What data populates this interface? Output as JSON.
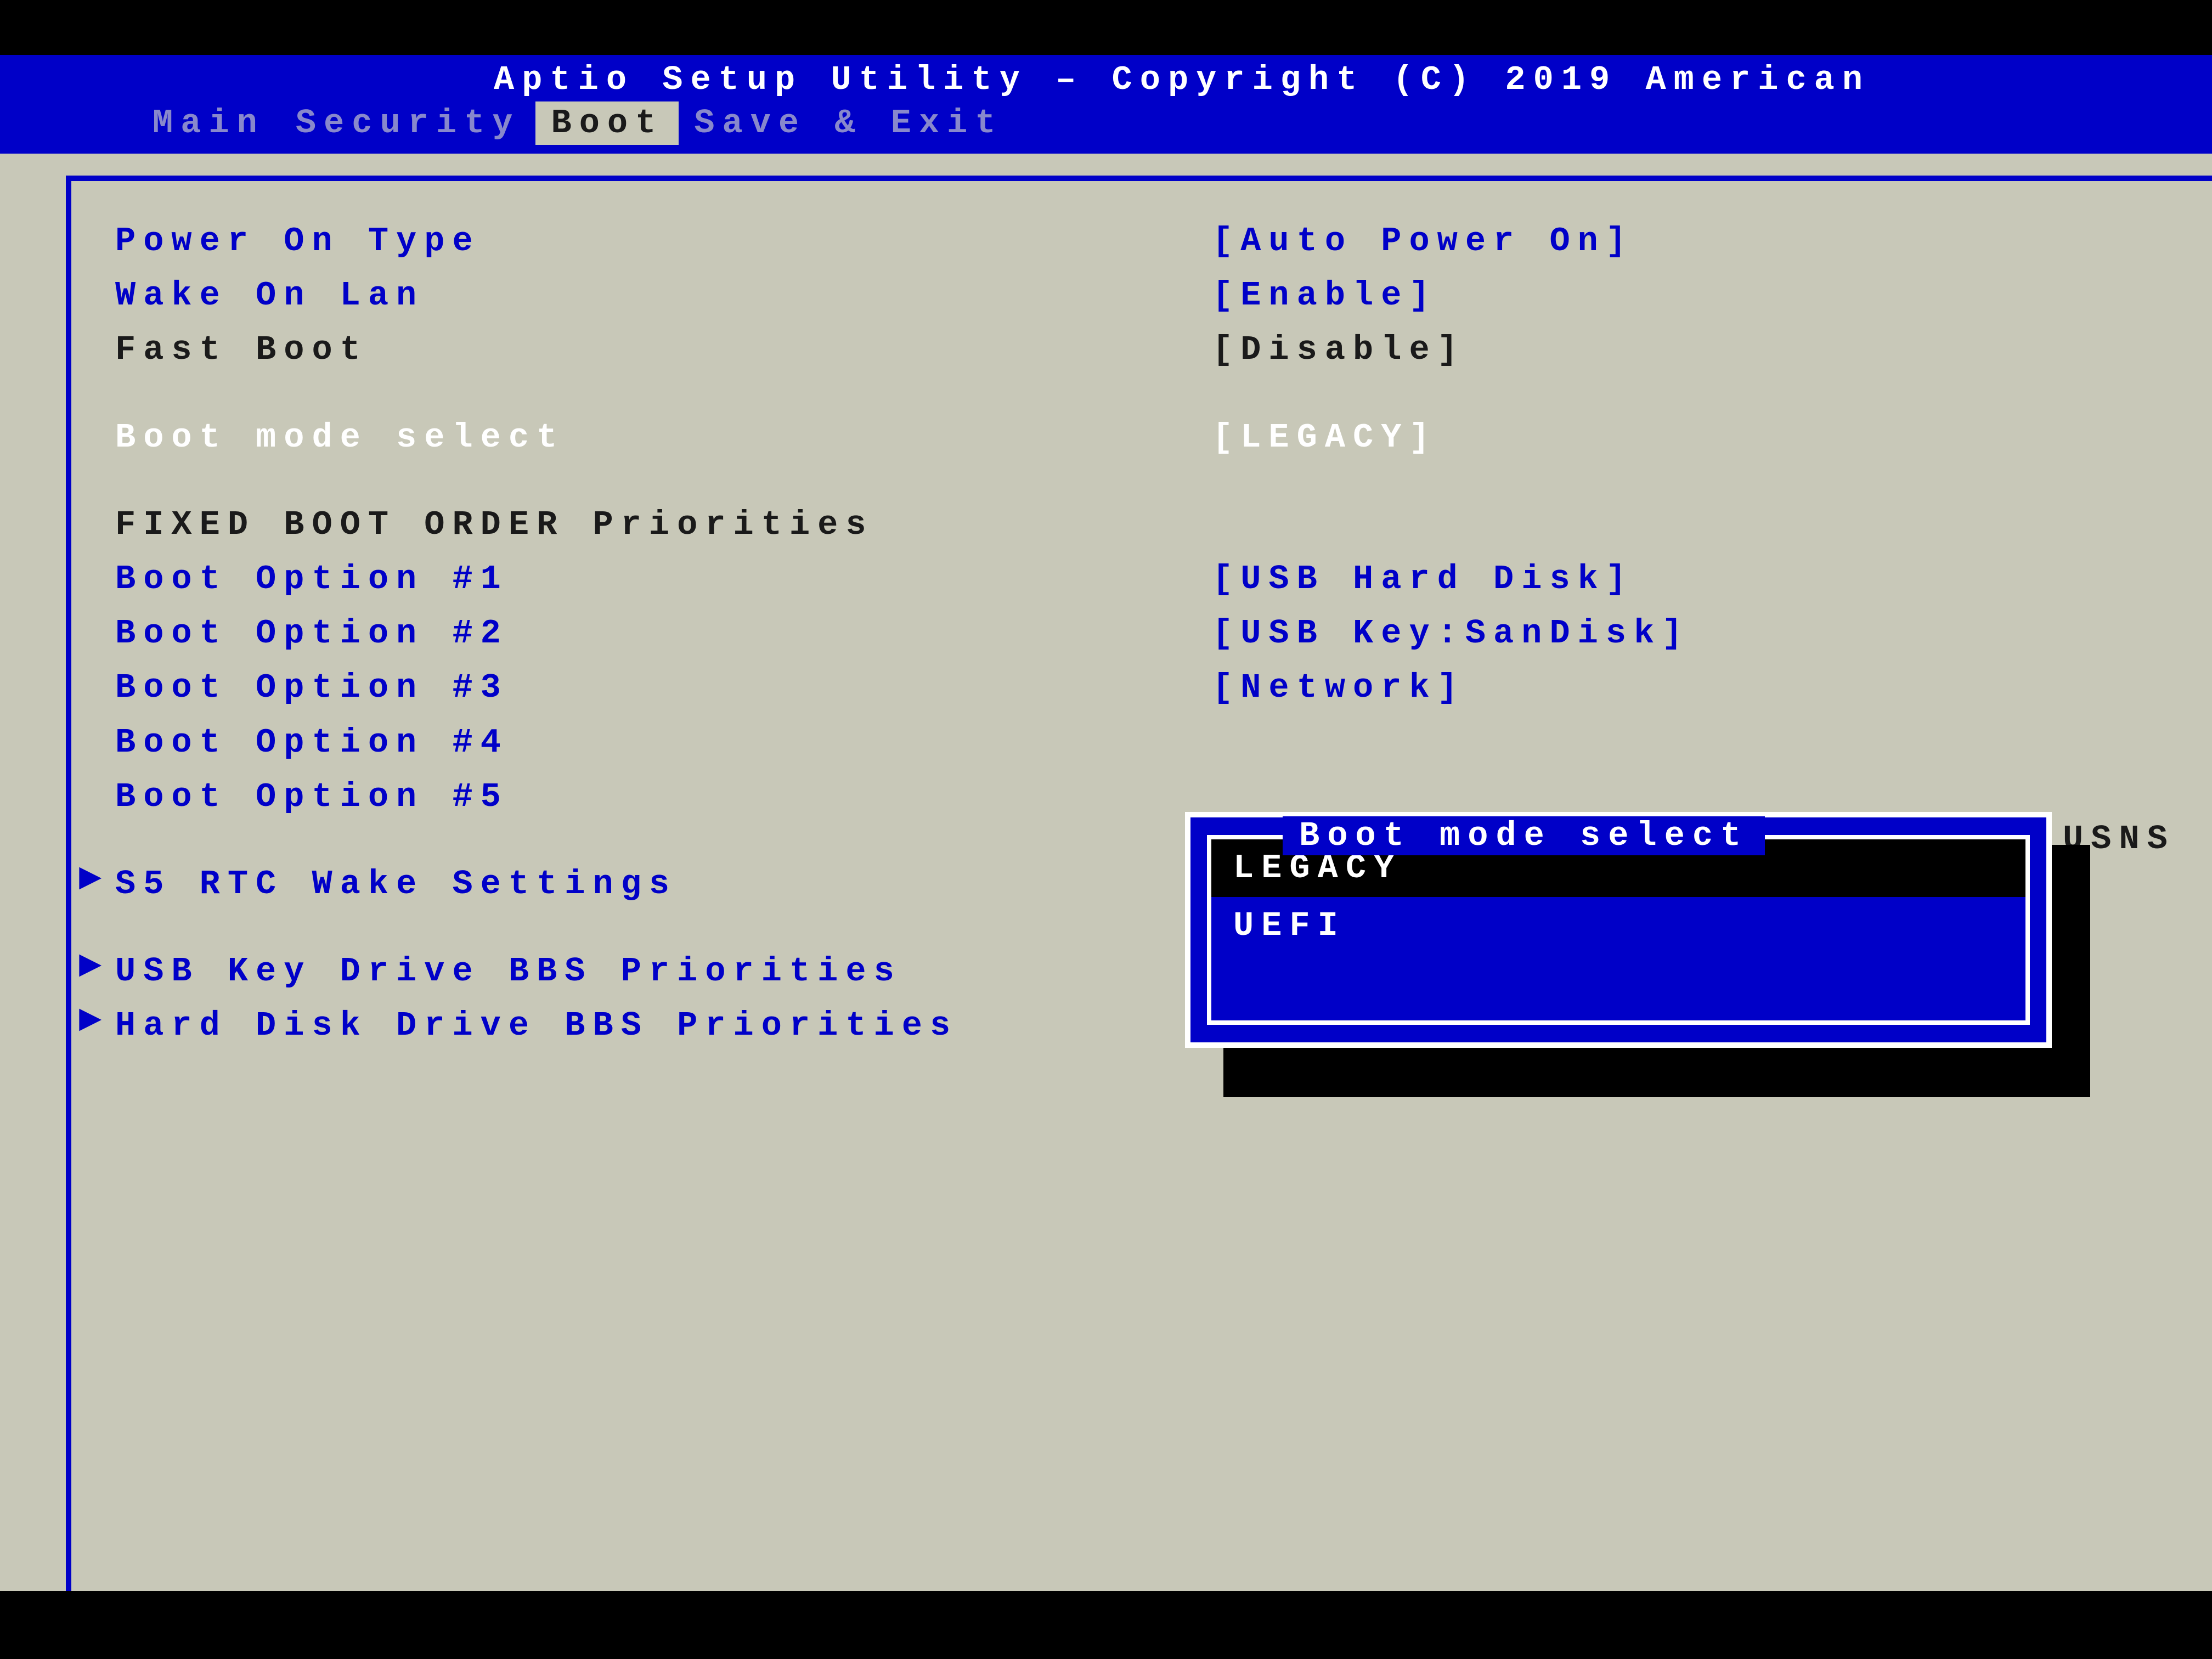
{
  "header": {
    "title": "Aptio Setup Utility – Copyright (C) 2019 American"
  },
  "tabs": {
    "items": [
      {
        "label": "Main",
        "active": false
      },
      {
        "label": "Security",
        "active": false
      },
      {
        "label": "Boot",
        "active": true
      },
      {
        "label": "Save & Exit",
        "active": false
      }
    ]
  },
  "settings": {
    "power_on_type": {
      "label": "Power On Type",
      "value": "[Auto Power On]"
    },
    "wake_on_lan": {
      "label": "Wake On Lan",
      "value": "[Enable]"
    },
    "fast_boot": {
      "label": "Fast Boot",
      "value": "[Disable]"
    },
    "boot_mode_select": {
      "label": "Boot mode select",
      "value": "[LEGACY]"
    },
    "fixed_boot_header": "FIXED BOOT ORDER Priorities",
    "boot_option_1": {
      "label": "Boot Option #1",
      "value": "[USB Hard Disk]"
    },
    "boot_option_2": {
      "label": "Boot Option #2",
      "value": "[USB Key:SanDisk]"
    },
    "boot_option_3": {
      "label": "Boot Option #3",
      "value": "[Network]"
    },
    "boot_option_4": {
      "label": "Boot Option #4",
      "value": ""
    },
    "boot_option_5": {
      "label": "Boot Option #5",
      "value": ""
    },
    "s5_rtc": {
      "label": "S5 RTC Wake Settings"
    },
    "usb_key_bbs": {
      "label": "USB Key Drive BBS Priorities"
    },
    "hard_disk_bbs": {
      "label": "Hard Disk Drive BBS Priorities"
    }
  },
  "side_text": "USNS",
  "popup": {
    "title": "Boot mode select",
    "options": [
      {
        "label": "LEGACY",
        "selected": true
      },
      {
        "label": "UEFI",
        "selected": false
      }
    ]
  }
}
